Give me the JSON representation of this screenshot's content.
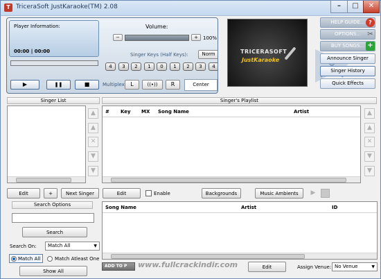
{
  "window": {
    "title": "TriceraSoft JustKaraoke(TM) 2.08",
    "min": "–",
    "max": "□",
    "close": "✕"
  },
  "player": {
    "info_label": "Player Information:",
    "time": "00:00 | 00:00",
    "volume_label": "Volume:",
    "volume_minus": "−",
    "volume_plus": "+",
    "volume_value": "100%",
    "volume_level": 1.0,
    "progress": 0,
    "singer_keys_label": "Singer Keys (Half Keys):",
    "norm_label": "Norm",
    "keys": [
      "4",
      "3",
      "2",
      "1",
      "0",
      "1",
      "2",
      "3",
      "4"
    ],
    "play": "▶",
    "pause": "❚❚",
    "stop": "■",
    "multiplex_label": "Multiplex",
    "mp_left": "L",
    "mp_stereo": "((•))",
    "mp_right": "R",
    "center_label": "Center"
  },
  "logo": {
    "brand_top": "TRICERASOFT",
    "brand_bottom": "JustKaraoke"
  },
  "side": {
    "help": "HELP GUIDE...",
    "options": "OPTIONS...",
    "buy": "BUY SONGS...",
    "announce": "Announce Singer",
    "history": "Singer History",
    "effects": "Quick Effects"
  },
  "singer_list": {
    "header": "Singer List"
  },
  "playlist": {
    "header": "Singer's Playlist",
    "columns": [
      "#",
      "Key",
      "MX",
      "Song Name",
      "Artist"
    ]
  },
  "singer_actions": {
    "edit": "Edit",
    "add": "+",
    "next": "Next Singer"
  },
  "playlist_actions": {
    "edit": "Edit",
    "enable": "Enable",
    "backgrounds": "Backgrounds",
    "ambients": "Music Ambients"
  },
  "search": {
    "options_label": "Search Options",
    "button": "Search",
    "search_on_label": "Search On:",
    "search_on_value": "Match All",
    "radio_all": "Match All",
    "radio_one": "Match Atleast One",
    "show_all": "Show All"
  },
  "results": {
    "columns": [
      "Song Name",
      "Artist",
      "ID"
    ]
  },
  "bottom": {
    "add_to": "ADD TO P",
    "edit": "Edit",
    "assign_label": "Assign Venue:",
    "venue_value": "No Venue",
    "watermark": "www.fullcrackindir.com"
  }
}
